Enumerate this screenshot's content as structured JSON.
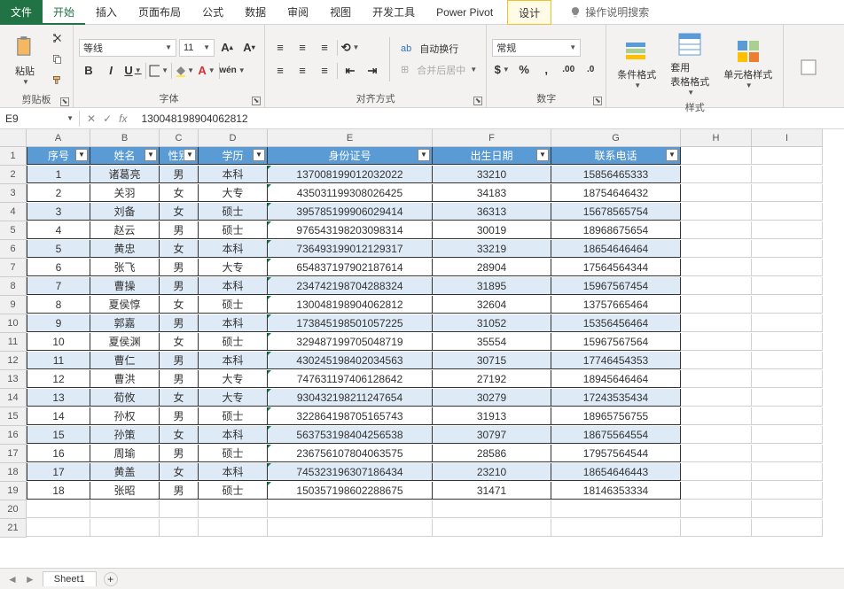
{
  "tabs": {
    "file": "文件",
    "start": "开始",
    "insert": "插入",
    "pagelayout": "页面布局",
    "formula": "公式",
    "data": "数据",
    "review": "审阅",
    "view": "视图",
    "dev": "开发工具",
    "powerpivot": "Power Pivot",
    "design": "设计",
    "tellme": "操作说明搜索"
  },
  "ribbon": {
    "clipboard": {
      "paste": "粘贴",
      "label": "剪贴板"
    },
    "font": {
      "name": "等线",
      "size": "11",
      "label": "字体"
    },
    "align": {
      "wrap": "自动换行",
      "merge": "合并后居中",
      "label": "对齐方式"
    },
    "number": {
      "format": "常规",
      "label": "数字"
    },
    "styles": {
      "cond": "条件格式",
      "table": "套用\n表格格式",
      "cell": "单元格样式",
      "label": "样式"
    }
  },
  "namebox": "E9",
  "formula": "130048198904062812",
  "cols": [
    "A",
    "B",
    "C",
    "D",
    "E",
    "F",
    "G",
    "H",
    "I"
  ],
  "colWidths": [
    "c-A",
    "c-B",
    "c-C",
    "c-D",
    "c-E",
    "c-F",
    "c-G",
    "c-H",
    "c-I"
  ],
  "headers": [
    "序号",
    "姓名",
    "性别",
    "学历",
    "身份证号",
    "出生日期",
    "联系电话"
  ],
  "rows": [
    [
      1,
      "诸葛亮",
      "男",
      "本科",
      "137008199012032022",
      "33210",
      "15856465333"
    ],
    [
      2,
      "关羽",
      "女",
      "大专",
      "435031199308026425",
      "34183",
      "18754646432"
    ],
    [
      3,
      "刘备",
      "女",
      "硕士",
      "395785199906029414",
      "36313",
      "15678565754"
    ],
    [
      4,
      "赵云",
      "男",
      "硕士",
      "976543198203098314",
      "30019",
      "18968675654"
    ],
    [
      5,
      "黄忠",
      "女",
      "本科",
      "736493199012129317",
      "33219",
      "18654646464"
    ],
    [
      6,
      "张飞",
      "男",
      "大专",
      "654837197902187614",
      "28904",
      "17564564344"
    ],
    [
      7,
      "曹操",
      "男",
      "本科",
      "234742198704288324",
      "31895",
      "15967567454"
    ],
    [
      8,
      "夏侯惇",
      "女",
      "硕士",
      "130048198904062812",
      "32604",
      "13757665464"
    ],
    [
      9,
      "郭嘉",
      "男",
      "本科",
      "173845198501057225",
      "31052",
      "15356456464"
    ],
    [
      10,
      "夏侯渊",
      "女",
      "硕士",
      "329487199705048719",
      "35554",
      "15967567564"
    ],
    [
      11,
      "曹仁",
      "男",
      "本科",
      "430245198402034563",
      "30715",
      "17746454353"
    ],
    [
      12,
      "曹洪",
      "男",
      "大专",
      "747631197406128642",
      "27192",
      "18945646464"
    ],
    [
      13,
      "荀攸",
      "女",
      "大专",
      "930432198211247654",
      "30279",
      "17243535434"
    ],
    [
      14,
      "孙权",
      "男",
      "硕士",
      "322864198705165743",
      "31913",
      "18965756755"
    ],
    [
      15,
      "孙策",
      "女",
      "本科",
      "563753198404256538",
      "30797",
      "18675564554"
    ],
    [
      16,
      "周瑜",
      "男",
      "硕士",
      "236756107804063575",
      "28586",
      "17957564544"
    ],
    [
      17,
      "黄盖",
      "女",
      "本科",
      "745323196307186434",
      "23210",
      "18654646443"
    ],
    [
      18,
      "张昭",
      "男",
      "硕士",
      "150357198602288675",
      "31471",
      "18146353334"
    ]
  ],
  "sheet": "Sheet1"
}
